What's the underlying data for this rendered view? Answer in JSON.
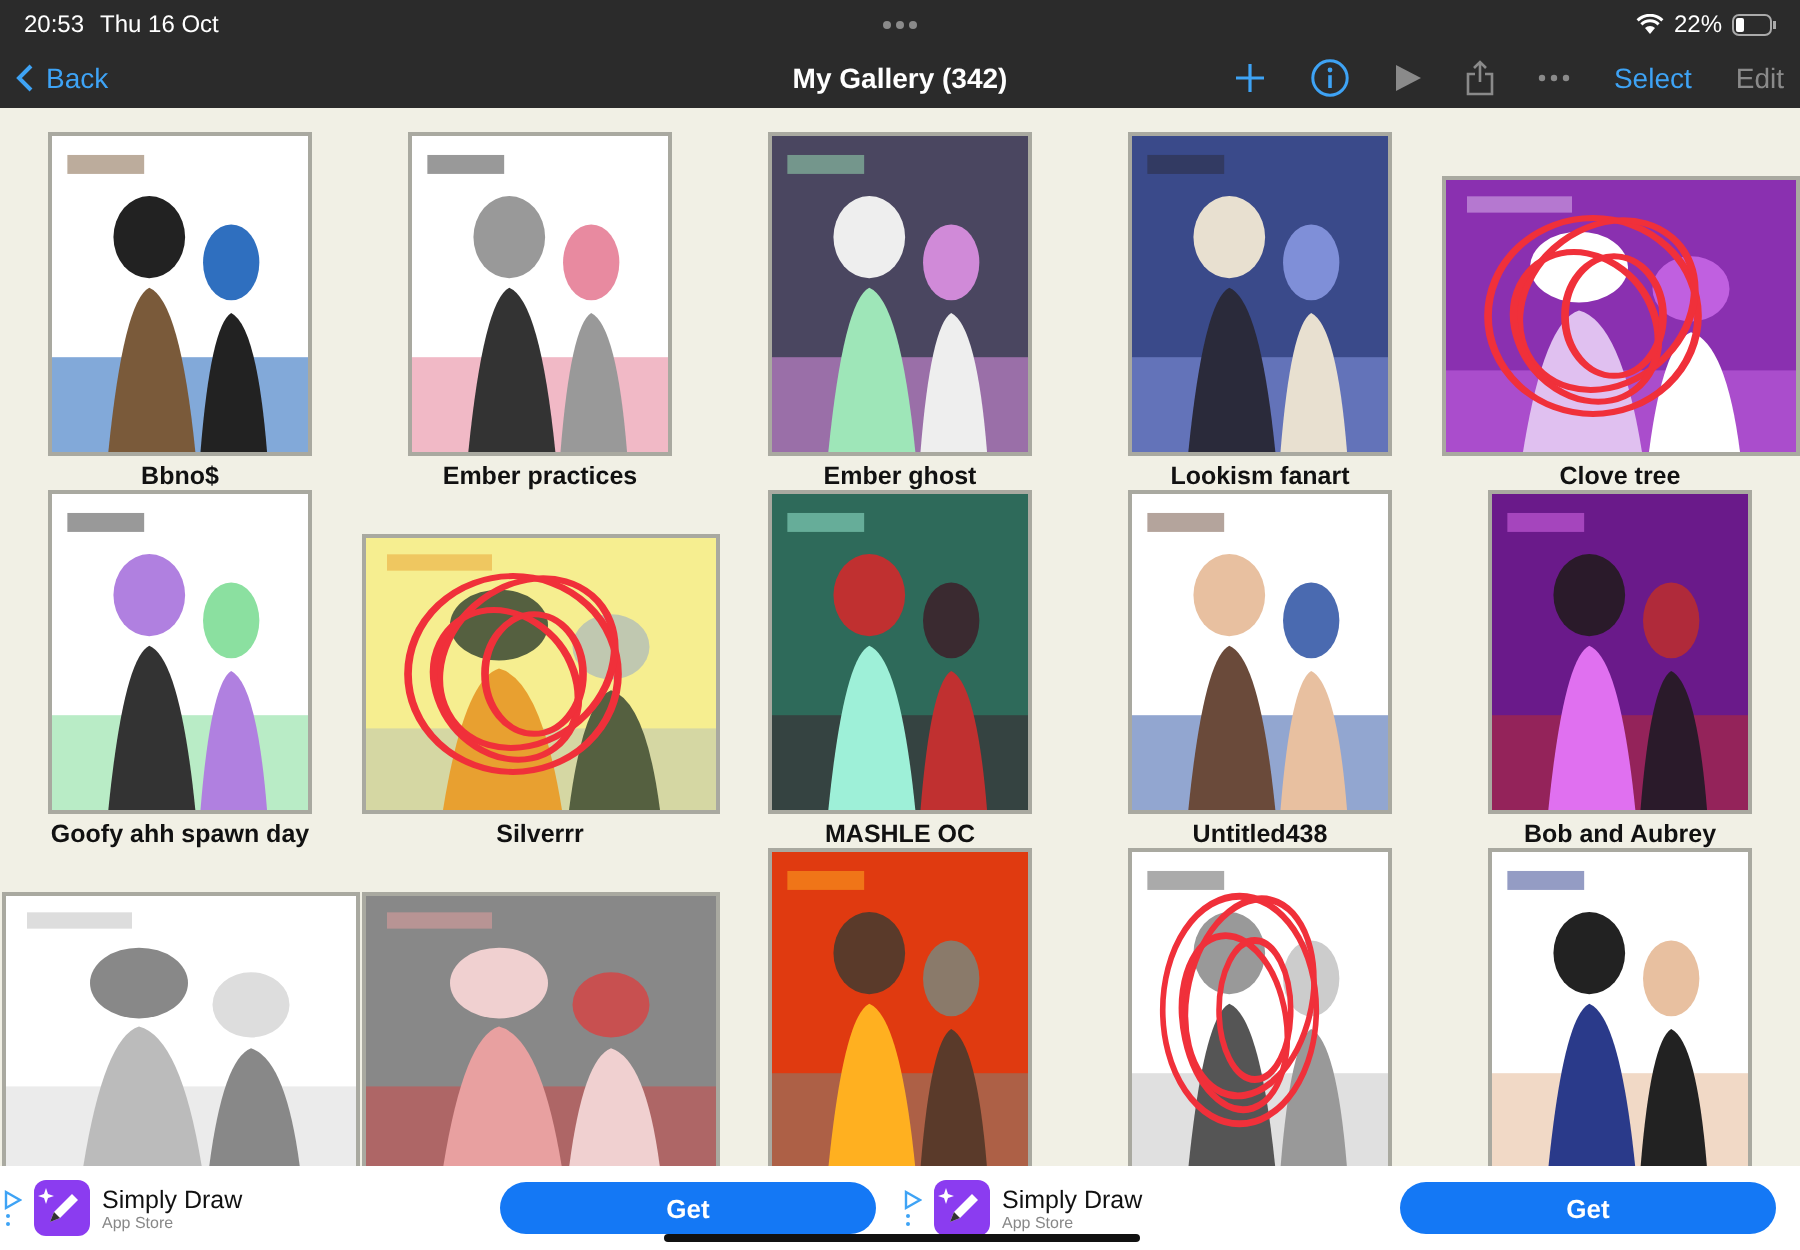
{
  "status_bar": {
    "time": "20:53",
    "date": "Thu 16 Oct",
    "battery": "22%"
  },
  "nav": {
    "back": "Back",
    "title": "My Gallery (342)",
    "select": "Select",
    "edit": {
      "label": "Edit",
      "disabled": true
    }
  },
  "gallery": [
    {
      "kind": "picture",
      "landscape": false,
      "title": "Bbno$"
    },
    {
      "kind": "picture",
      "landscape": false,
      "title": "Ember practices"
    },
    {
      "kind": "picture",
      "landscape": false,
      "title": "Ember ghost"
    },
    {
      "kind": "picture",
      "landscape": false,
      "title": "Lookism fanart"
    },
    {
      "kind": "picture",
      "landscape": true,
      "title": "Clove tree"
    },
    {
      "kind": "picture",
      "landscape": false,
      "title": "Goofy ahh spawn day"
    },
    {
      "kind": "picture",
      "landscape": true,
      "title": "Silverrr"
    },
    {
      "kind": "picture",
      "landscape": false,
      "title": "MASHLE OC"
    },
    {
      "kind": "picture",
      "landscape": false,
      "title": "Untitled438"
    },
    {
      "kind": "picture",
      "landscape": false,
      "title": "Bob and Aubrey"
    },
    {
      "kind": "picture",
      "landscape": true
    },
    {
      "kind": "picture",
      "landscape": true
    },
    {
      "kind": "picture",
      "landscape": false
    },
    {
      "kind": "picture",
      "landscape": false
    },
    {
      "kind": "picture",
      "landscape": false
    }
  ],
  "ads": [
    {
      "name": "Simply Draw",
      "store": "App Store",
      "button": "Get"
    },
    {
      "name": "Simply Draw",
      "store": "App Store",
      "button": "Get"
    }
  ]
}
